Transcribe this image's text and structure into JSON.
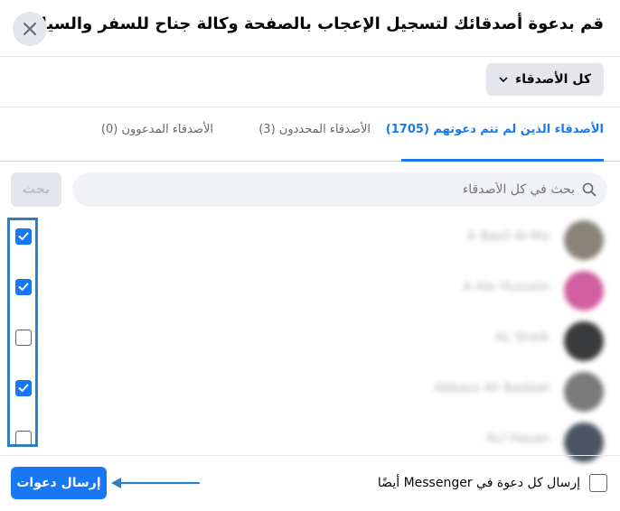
{
  "dialog": {
    "title": "قم بدعوة أصدقائك لتسجيل الإعجاب بالصفحة وكالة جناح للسفر والسياحة",
    "close_icon": "close-icon"
  },
  "filter": {
    "label": "كل الأصدقاء",
    "icon": "chevron-down-icon"
  },
  "tabs": [
    {
      "label": "الأصدقاء الذين لم تتم دعوتهم (1705)",
      "active": true
    },
    {
      "label": "الأصدقاء المحددون (3)",
      "active": false
    },
    {
      "label": "الأصدقاء المدعوون (0)",
      "active": false
    }
  ],
  "search": {
    "placeholder": "بحث في كل الأصدقاء",
    "button_label": "بحث",
    "icon": "search-icon"
  },
  "friends": [
    {
      "name": "A Basil Al-Mo",
      "checked": true,
      "avatar_color": "#8a8478"
    },
    {
      "name": "A Ale Hussein",
      "checked": true,
      "avatar_color": "#d25fa0"
    },
    {
      "name": "AL Sheik",
      "checked": false,
      "avatar_color": "#3a3b3c"
    },
    {
      "name": "Abbass Ali Badawi",
      "checked": true,
      "avatar_color": "#7a7a7a"
    },
    {
      "name": "ALI Hasan",
      "checked": false,
      "avatar_color": "#4b5563"
    }
  ],
  "footer": {
    "messenger_label": "إرسال كل دعوة في Messenger أيضًا",
    "send_label": "إرسال دعوات"
  },
  "colors": {
    "accent": "#1877f2",
    "highlight": "#2f7fbf"
  }
}
